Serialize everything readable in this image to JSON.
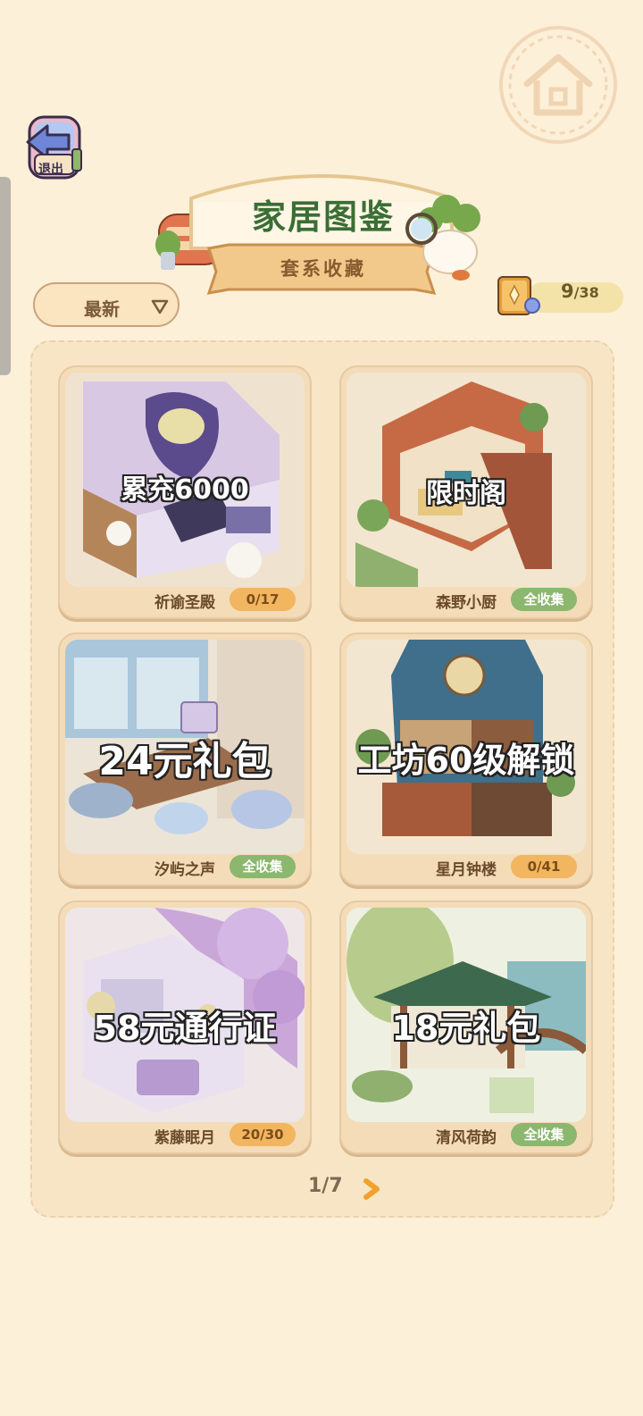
{
  "header": {
    "title": "家居图鉴",
    "subtitle": "套系收藏",
    "exit_label": "退出"
  },
  "sort": {
    "label": "最新"
  },
  "collection_progress": {
    "collected": "9",
    "total": "/38"
  },
  "cards": [
    {
      "name": "祈谕圣殿",
      "overlay": "累充6000",
      "badge": "0/17",
      "badge_style": "orange"
    },
    {
      "name": "森野小厨",
      "overlay": "限时阁",
      "badge": "全收集",
      "badge_style": "green"
    },
    {
      "name": "汐屿之声",
      "overlay": "24元礼包",
      "badge": "全收集",
      "badge_style": "green"
    },
    {
      "name": "星月钟楼",
      "overlay": "工坊60级解锁",
      "badge": "0/41",
      "badge_style": "orange"
    },
    {
      "name": "紫藤眠月",
      "overlay": "58元通行证",
      "badge": "20/30",
      "badge_style": "orange"
    },
    {
      "name": "清风荷韵",
      "overlay": "18元礼包",
      "badge": "全收集",
      "badge_style": "green"
    }
  ],
  "pager": {
    "text": "1/7"
  },
  "colors": {
    "background": "#fdf0d8",
    "title_green": "#3a6e35",
    "badge_orange": "#f2b560",
    "badge_green": "#8bb76e"
  }
}
